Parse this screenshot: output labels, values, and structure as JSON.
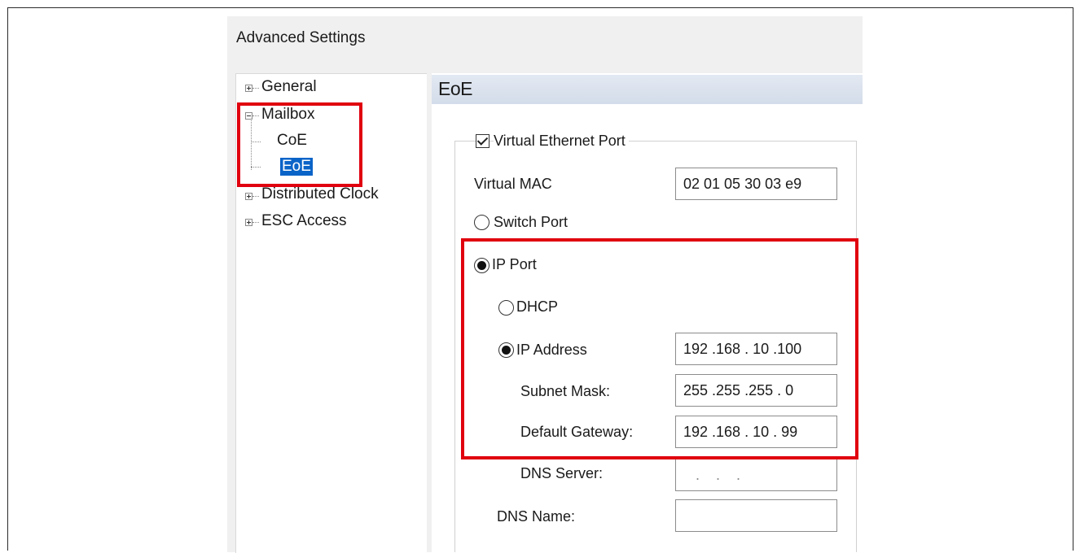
{
  "window": {
    "title": "Advanced Settings"
  },
  "tree": {
    "items": [
      {
        "label": "General",
        "expander": "plus"
      },
      {
        "label": "Mailbox",
        "expander": "minus"
      },
      {
        "label": "CoE"
      },
      {
        "label": "EoE",
        "selected": true
      },
      {
        "label": "Distributed Clock",
        "expander": "plus"
      },
      {
        "label": "ESC Access",
        "expander": "plus"
      }
    ]
  },
  "panel": {
    "header": "EoE",
    "virtual_ethernet_port": {
      "label": "Virtual Ethernet Port",
      "checked": true
    },
    "virtual_mac": {
      "label": "Virtual MAC",
      "value": "02 01 05 30 03 e9"
    },
    "switch_port": {
      "label": "Switch Port",
      "selected": false
    },
    "ip_port": {
      "label": "IP Port",
      "selected": true
    },
    "dhcp": {
      "label": "DHCP",
      "selected": false
    },
    "ip_address": {
      "label": "IP Address",
      "selected": true,
      "value": "192 .168 . 10 .100"
    },
    "subnet_mask": {
      "label": "Subnet Mask:",
      "value": "255 .255 .255 . 0"
    },
    "default_gateway": {
      "label": "Default Gateway:",
      "value": "192 .168 . 10 . 99"
    },
    "dns_server": {
      "label": "DNS Server:",
      "value": "   .    .    .   "
    },
    "dns_name": {
      "label": "DNS Name:",
      "value": ""
    }
  },
  "colors": {
    "highlight": "#e0000f",
    "selection": "#0a64c8",
    "header_bg": "#d9e1ec"
  },
  "icons": [
    "tree-expand-plus-icon",
    "tree-collapse-minus-icon",
    "checkbox-checked-icon",
    "radio-selected-icon",
    "radio-unselected-icon"
  ]
}
